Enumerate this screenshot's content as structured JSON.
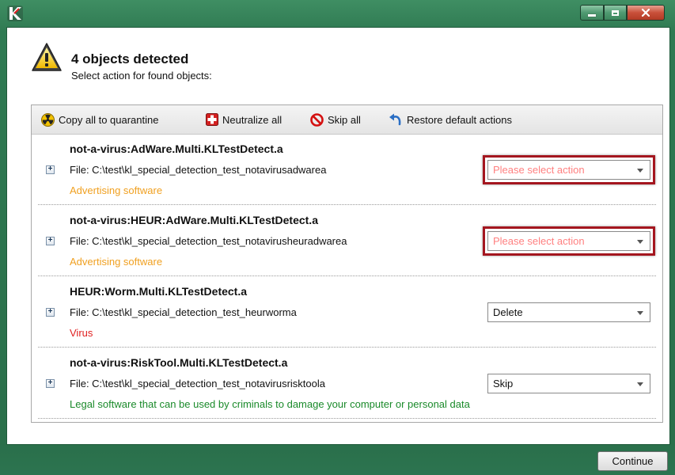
{
  "header": {
    "title": "4 objects detected",
    "subtitle": "Select action for found objects:"
  },
  "toolbar": {
    "quarantine_label": "Copy all to quarantine",
    "neutralize_label": "Neutralize all",
    "skip_label": "Skip all",
    "restore_label": "Restore default actions"
  },
  "objects": [
    {
      "name": "not-a-virus:AdWare.Multi.KLTestDetect.a",
      "file": "File: C:\\test\\kl_special_detection_test_notavirusadwarea",
      "category": "Advertising software",
      "action": "Please select action"
    },
    {
      "name": "not-a-virus:HEUR:AdWare.Multi.KLTestDetect.a",
      "file": "File: C:\\test\\kl_special_detection_test_notavirusheuradwarea",
      "category": "Advertising software",
      "action": "Please select action"
    },
    {
      "name": "HEUR:Worm.Multi.KLTestDetect.a",
      "file": "File: C:\\test\\kl_special_detection_test_heurworma",
      "category": "Virus",
      "action": "Delete"
    },
    {
      "name": "not-a-virus:RiskTool.Multi.KLTestDetect.a",
      "file": "File: C:\\test\\kl_special_detection_test_notavirusrisktoola",
      "category": "Legal software that can be used by criminals to damage your computer or personal data",
      "action": "Skip"
    }
  ],
  "footer": {
    "continue_label": "Continue"
  },
  "expand_glyph": "+",
  "colors": {
    "window_frame": "#2f7a52",
    "highlight": "#a4161f",
    "adware": "#f0a020",
    "virus": "#e02020",
    "legal": "#1a8a2a",
    "placeholder": "#ff8080"
  }
}
